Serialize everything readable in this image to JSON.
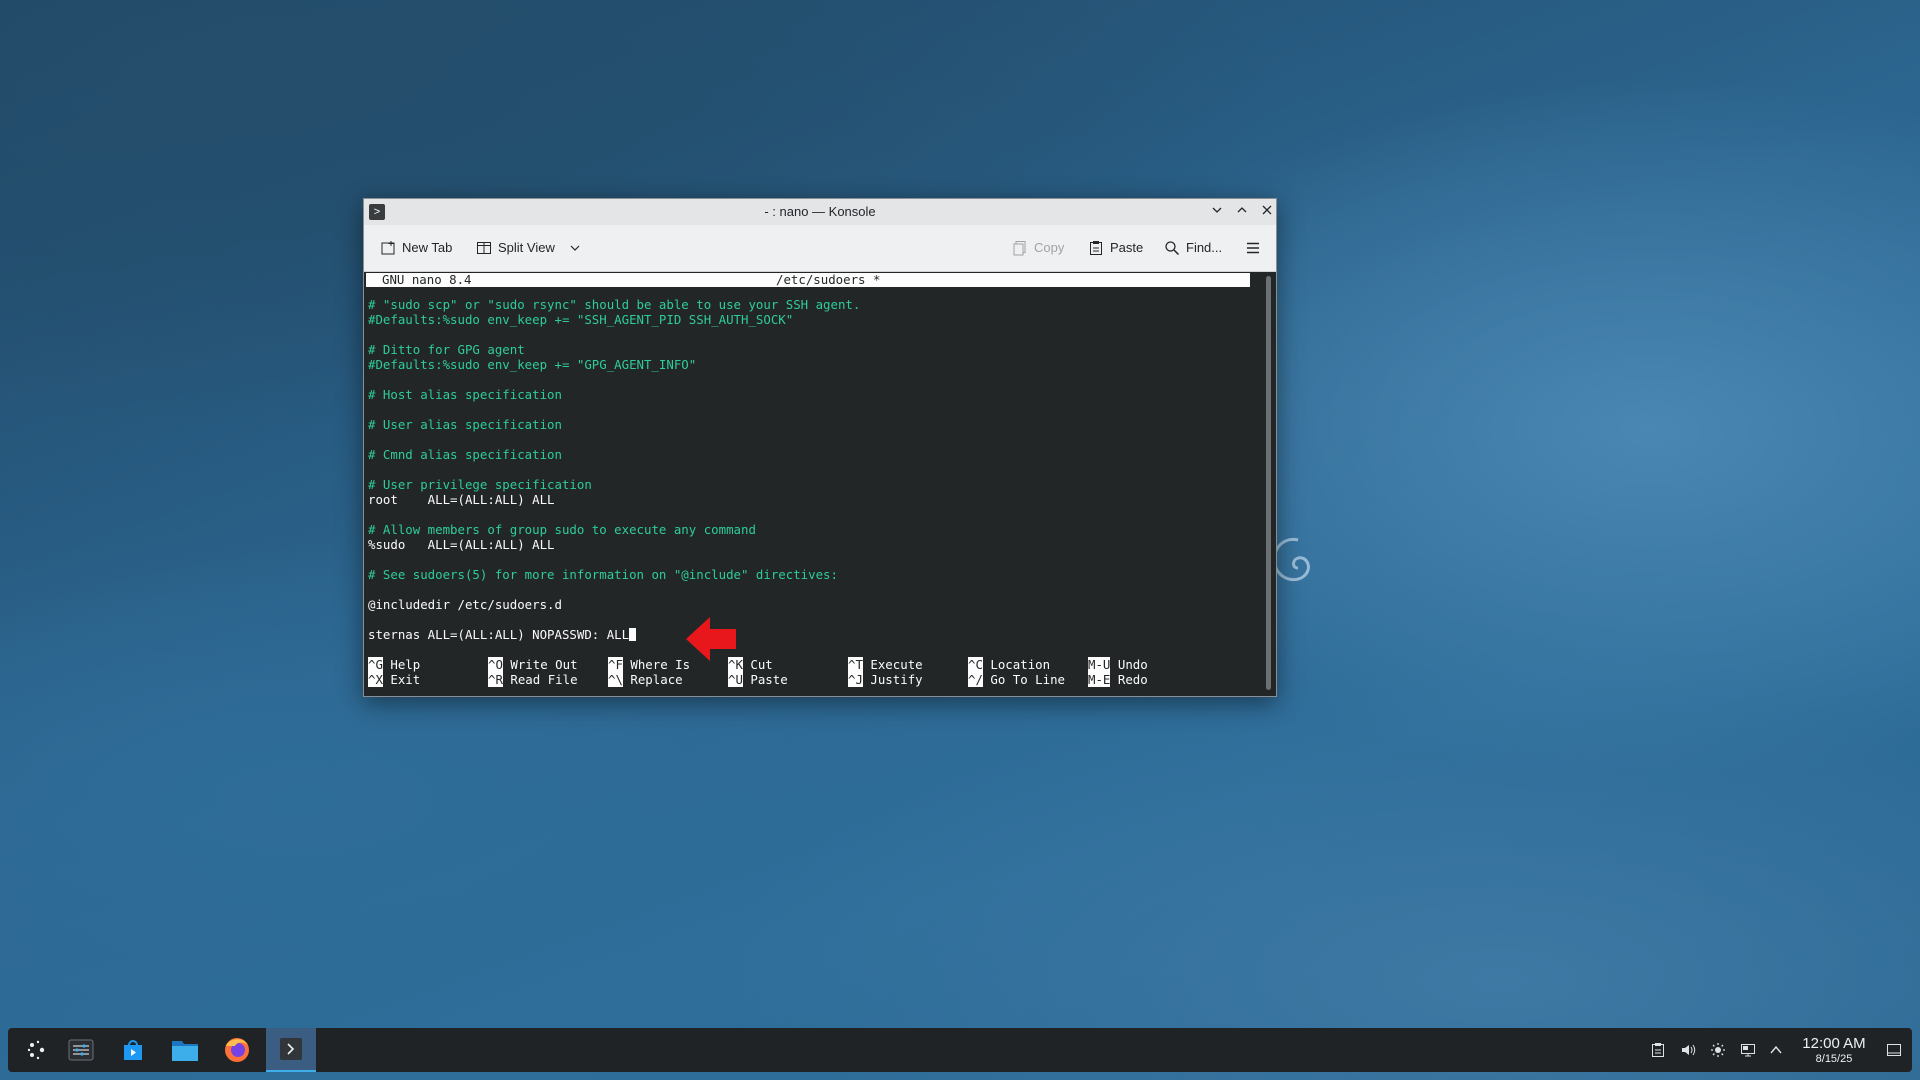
{
  "window": {
    "title": "- : nano — Konsole",
    "app_icon": "terminal-icon"
  },
  "toolbar": {
    "new_tab": "New Tab",
    "split_view": "Split View",
    "copy": "Copy",
    "paste": "Paste",
    "find": "Find..."
  },
  "nano": {
    "version": "GNU nano 8.4",
    "filename": "/etc/sudoers *",
    "lines": [
      "# \"sudo scp\" or \"sudo rsync\" should be able to use your SSH agent.",
      "#Defaults:%sudo env_keep += \"SSH_AGENT_PID SSH_AUTH_SOCK\"",
      "# Ditto for GPG agent",
      "#Defaults:%sudo env_keep += \"GPG_AGENT_INFO\"",
      "# Host alias specification",
      "# User alias specification",
      "# Cmnd alias specification",
      "# User privilege specification",
      "root    ALL=(ALL:ALL) ALL",
      "# Allow members of group sudo to execute any command",
      "%sudo   ALL=(ALL:ALL) ALL",
      "# See sudoers(5) for more information on \"@include\" directives:",
      "@includedir /etc/sudoers.d",
      "sternas ALL=(ALL:ALL) NOPASSWD: ALL"
    ],
    "shortcuts": [
      {
        "key": "^G",
        "label": "Help"
      },
      {
        "key": "^X",
        "label": "Exit"
      },
      {
        "key": "^O",
        "label": "Write Out"
      },
      {
        "key": "^R",
        "label": "Read File"
      },
      {
        "key": "^F",
        "label": "Where Is"
      },
      {
        "key": "^\\",
        "label": "Replace"
      },
      {
        "key": "^K",
        "label": "Cut"
      },
      {
        "key": "^U",
        "label": "Paste"
      },
      {
        "key": "^T",
        "label": "Execute"
      },
      {
        "key": "^J",
        "label": "Justify"
      },
      {
        "key": "^C",
        "label": "Location"
      },
      {
        "key": "^/",
        "label": "Go To Line"
      },
      {
        "key": "M-U",
        "label": "Undo"
      },
      {
        "key": "M-E",
        "label": "Redo"
      }
    ]
  },
  "taskbar": {
    "apps": [
      "application-launcher-icon",
      "system-settings-icon",
      "discover-store-icon",
      "file-manager-icon",
      "firefox-icon",
      "konsole-icon"
    ],
    "tray": [
      "clipboard-icon",
      "volume-icon",
      "brightness-icon",
      "network-icon",
      "chevron-up-icon"
    ],
    "time": "12:00 AM",
    "date": "8/15/25"
  },
  "colors": {
    "comment": "#2ecc9a",
    "text": "#fcfcfc",
    "terminal_bg": "#232627",
    "annotation_arrow": "#e8171b"
  }
}
